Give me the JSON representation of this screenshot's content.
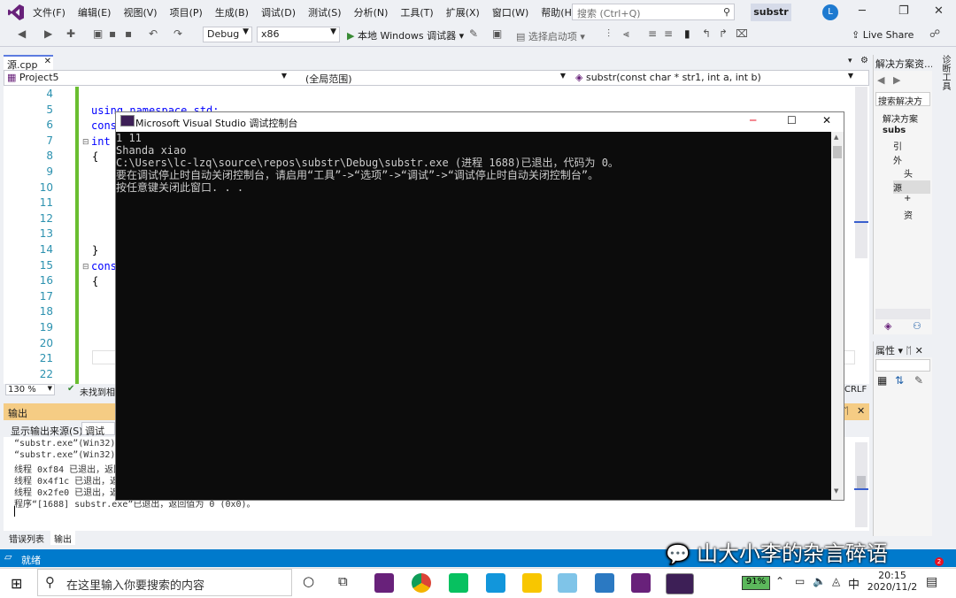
{
  "menubar": {
    "items": [
      "文件(F)",
      "编辑(E)",
      "视图(V)",
      "项目(P)",
      "生成(B)",
      "调试(D)",
      "测试(S)",
      "分析(N)",
      "工具(T)",
      "扩展(X)",
      "窗口(W)",
      "帮助(H)"
    ],
    "search_placeholder": "搜索 (Ctrl+Q)",
    "solution_name": "substr",
    "avatar_letter": "L"
  },
  "toolbar": {
    "config": "Debug",
    "platform": "x86",
    "run_label": "本地 Windows 调试器",
    "startup_item": "选择启动项",
    "live_share": "Live Share"
  },
  "editor": {
    "tab_name": "源.cpp",
    "nav_project": "Project5",
    "nav_scope": "(全局范围)",
    "nav_function": "substr(const char * str1, int a, int b)",
    "line_numbers": [
      "4",
      "5",
      "6",
      "7",
      "8",
      "9",
      "10",
      "11",
      "12",
      "13",
      "14",
      "15",
      "16",
      "17",
      "18",
      "19",
      "20",
      "21",
      "22"
    ],
    "code_lines": [
      {
        "text": "using namespace std;",
        "line": 5
      },
      {
        "text": "cons",
        "line": 6
      },
      {
        "text": "int",
        "line": 7
      },
      {
        "text": "{",
        "line": 8
      },
      {
        "text": "}",
        "line": 14
      },
      {
        "text": "cons",
        "line": 15
      },
      {
        "text": "{",
        "line": 16
      }
    ],
    "zoom": "130 %",
    "status_text": "未找到相",
    "line_ending": "CRLF"
  },
  "output": {
    "title": "输出",
    "source_label": "显示输出来源(S):",
    "source_value": "调试",
    "lines": [
      "“substr.exe”(Win32):",
      "“substr.exe”(Win32):",
      "线程 0xf84 已退出，返回",
      "线程 0x4f1c 已退出，返回",
      "线程 0x2fe0 已退出，返回",
      "程序“[1688] substr.exe”已退出，返回值为 0 (0x0)。"
    ],
    "tabs": [
      "错误列表",
      "输出"
    ]
  },
  "statusbar": {
    "text": "就绪"
  },
  "solution_explorer": {
    "title": "解决方案资...",
    "search": "搜索解决方",
    "items": [
      "解决方案",
      "subs",
      "引",
      "外",
      "头",
      "源",
      "+",
      "资"
    ]
  },
  "properties": {
    "title": "属性"
  },
  "console": {
    "title": "Microsoft Visual Studio 调试控制台",
    "lines": [
      "1 11",
      "Shanda xiao",
      "C:\\Users\\lc-lzq\\source\\repos\\substr\\Debug\\substr.exe (进程 1688)已退出，代码为 0。",
      "要在调试停止时自动关闭控制台，请启用“工具”->“选项”->“调试”->“调试停止时自动关闭控制台”。",
      "按任意键关闭此窗口. . ."
    ]
  },
  "taskbar": {
    "search_placeholder": "在这里输入你要搜索的内容",
    "battery": "91%",
    "ime": "中",
    "time": "20:15",
    "date": "2020/11/2",
    "notif_count": "2"
  },
  "watermark": {
    "text": "山大小李的杂言碎语"
  },
  "colors": {
    "accent": "#007acc",
    "vs_purple": "#68217a",
    "output_title": "#f5cc84"
  }
}
